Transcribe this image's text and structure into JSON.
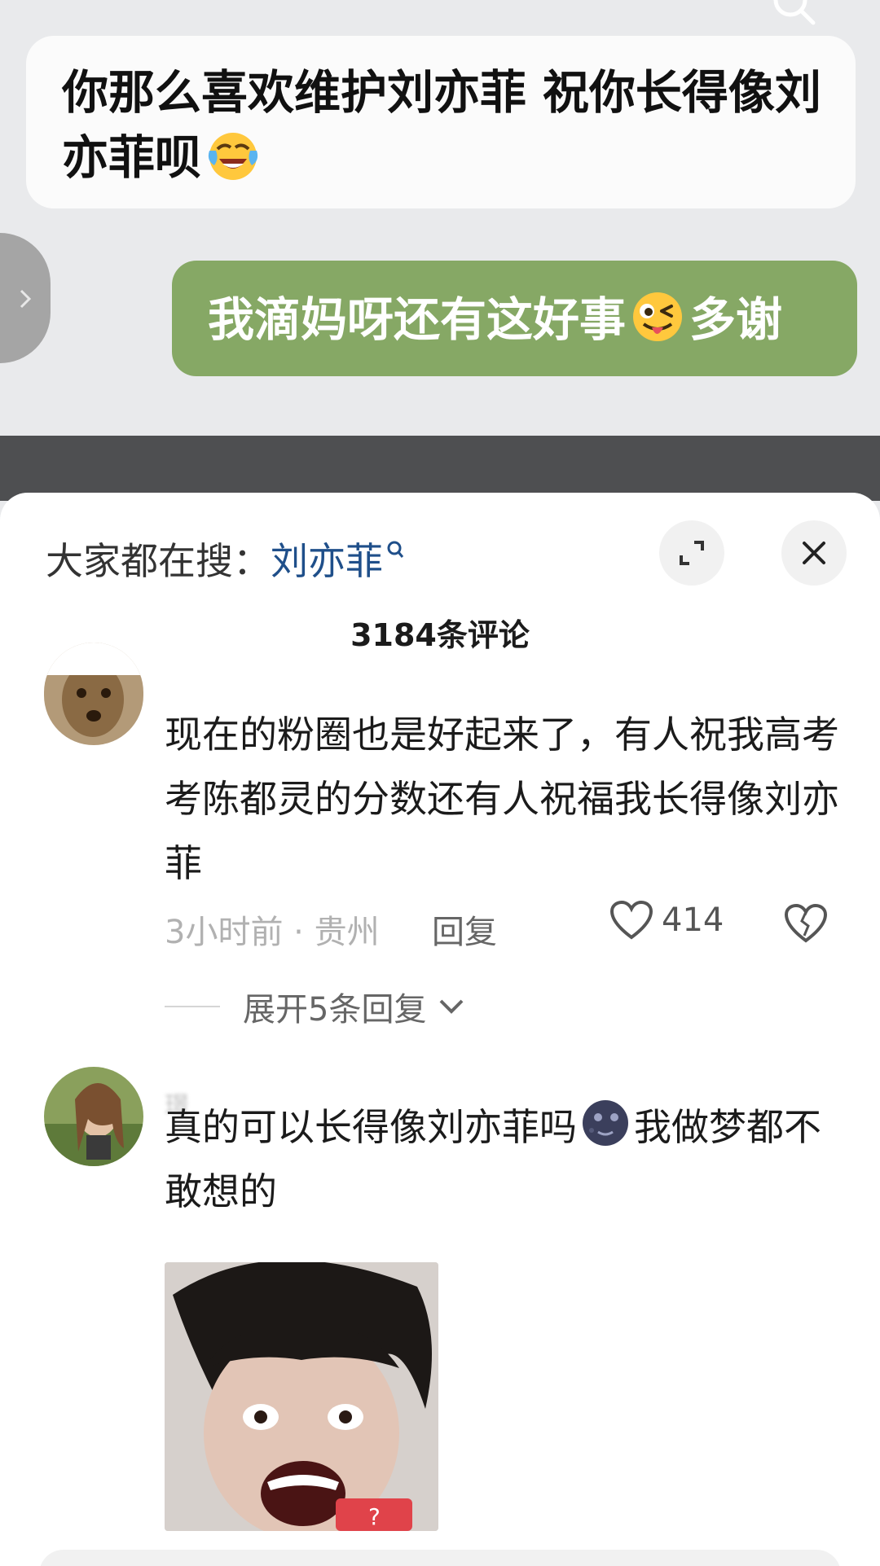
{
  "chat": {
    "incoming_message": "你那么喜欢维护刘亦菲 祝你长得像刘亦菲呗",
    "incoming_emoji": "laughing-crying-emoji",
    "outgoing_text_before": "我滴妈呀还有这好事",
    "outgoing_emoji": "winking-tongue-emoji",
    "outgoing_text_after": "多谢"
  },
  "sheet": {
    "hot_search_prefix": "大家都在搜：",
    "hot_search_keyword": "刘亦菲",
    "comment_count": "3184条评论"
  },
  "comments": [
    {
      "text": "现在的粉圈也是好起来了，有人祝我高考考陈都灵的分数还有人祝福我长得像刘亦菲",
      "meta": "3小时前 · 贵州",
      "reply_label": "回复",
      "likes": "414",
      "expand_label": "展开5条回复"
    },
    {
      "username": "璟",
      "text_before": "真的可以长得像刘亦菲吗",
      "emoji": "new-moon-face-emoji",
      "text_after": "我做梦都不敢想的"
    }
  ],
  "colors": {
    "chat_bg": "#e9eaec",
    "outgoing_bubble": "#86a865",
    "keyword_blue": "#1f4f8a"
  }
}
